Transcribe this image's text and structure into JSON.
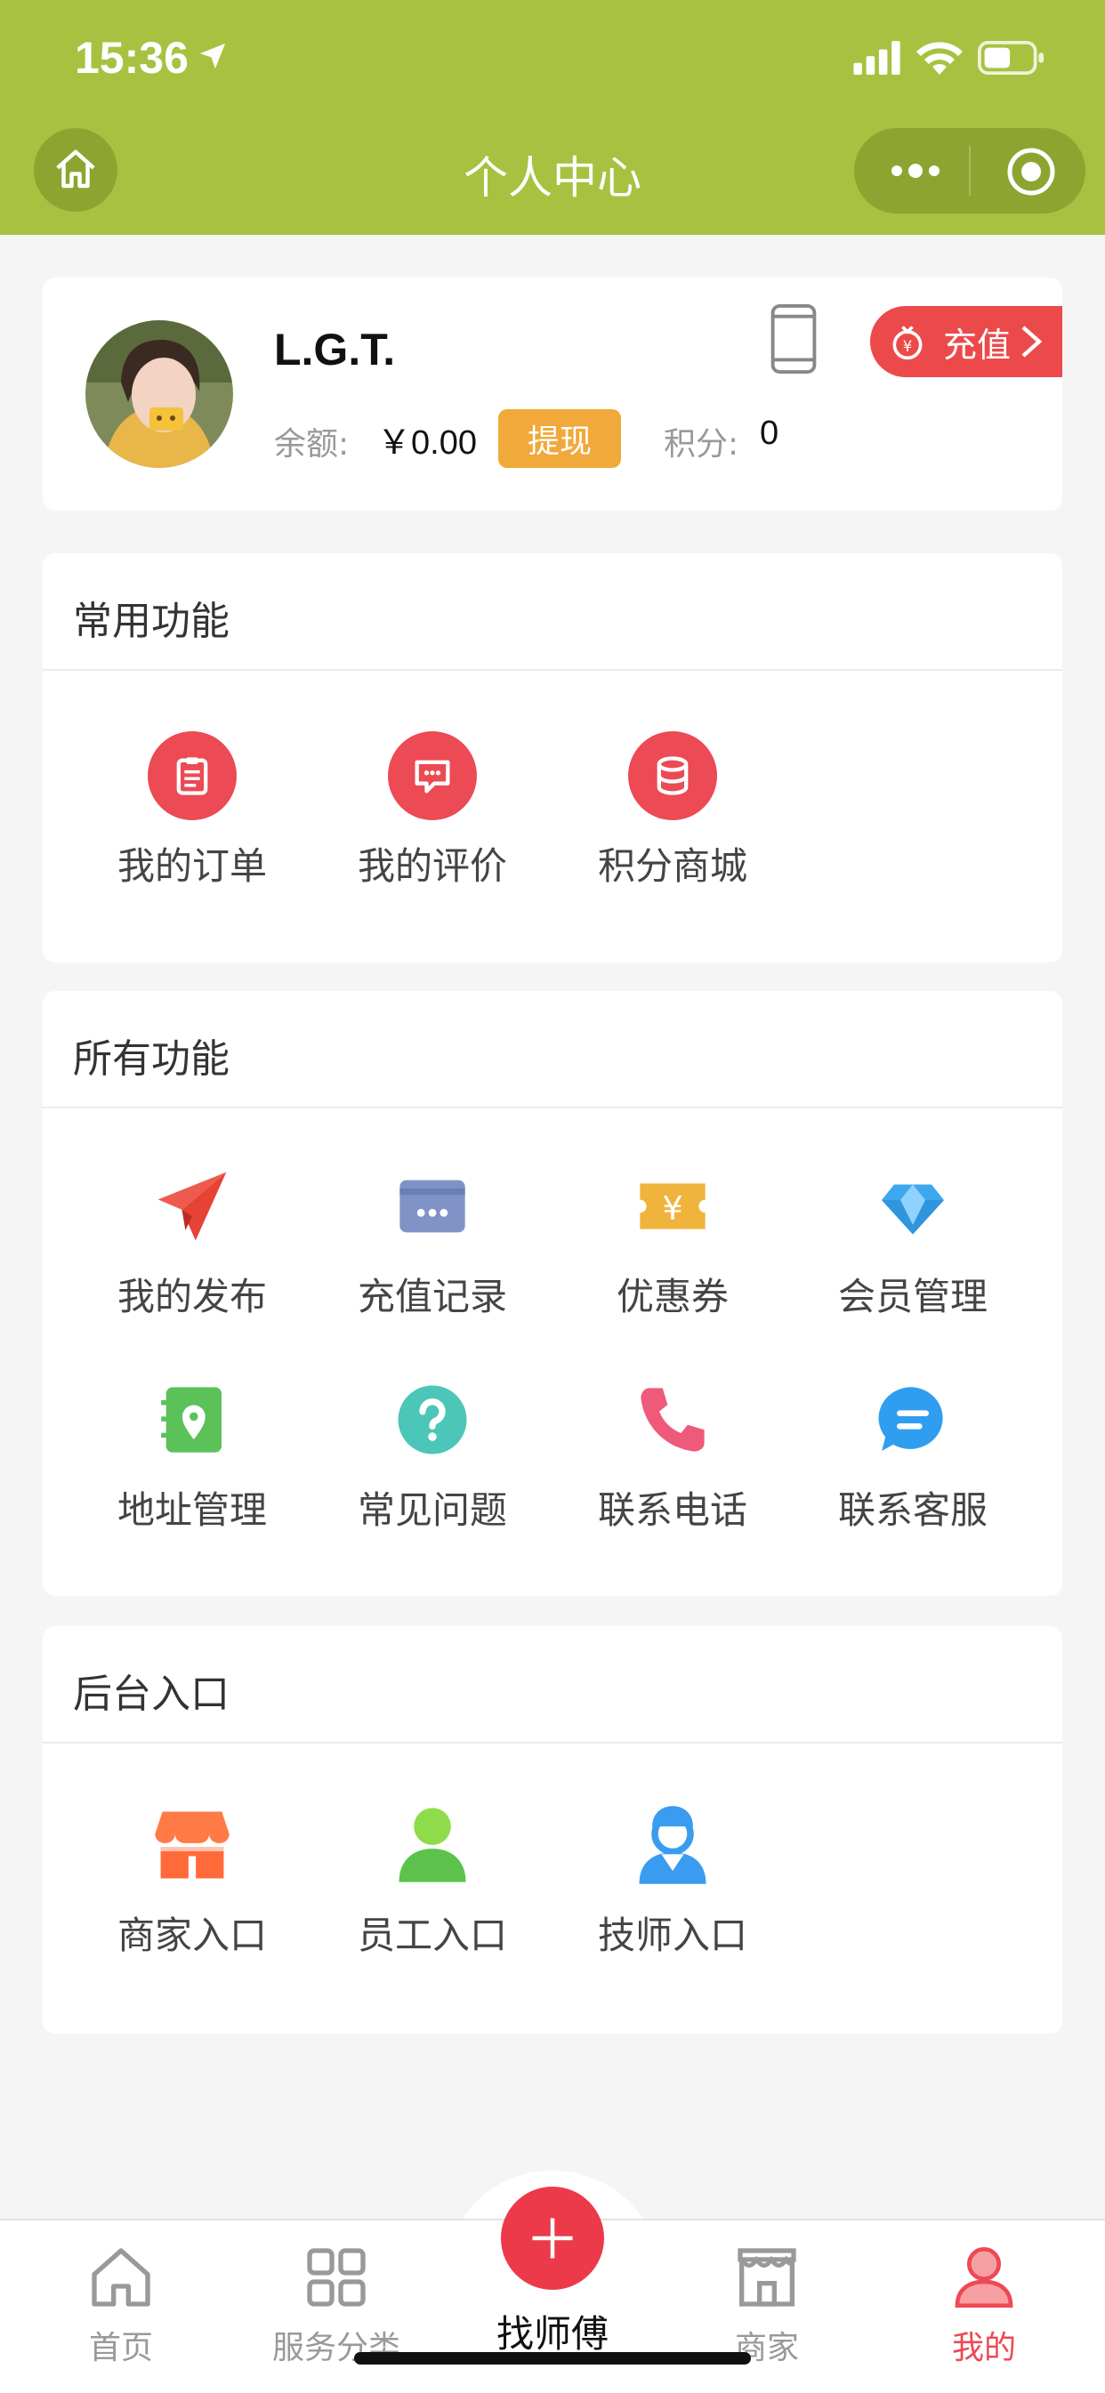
{
  "status_bar": {
    "time": "15:36"
  },
  "nav": {
    "title": "个人中心"
  },
  "profile": {
    "name": "L.G.T.",
    "balance_label": "余额:",
    "balance_value": "￥0.00",
    "withdraw_label": "提现",
    "points_label": "积分:",
    "points_value": "0",
    "recharge_label": "充值"
  },
  "common": {
    "title": "常用功能",
    "items": [
      {
        "label": "我的订单",
        "icon": "clipboard-icon"
      },
      {
        "label": "我的评价",
        "icon": "comment-icon"
      },
      {
        "label": "积分商城",
        "icon": "database-icon"
      }
    ]
  },
  "all": {
    "title": "所有功能",
    "items": [
      {
        "label": "我的发布",
        "icon": "paper-plane-icon"
      },
      {
        "label": "充值记录",
        "icon": "card-icon"
      },
      {
        "label": "优惠券",
        "icon": "coupon-icon"
      },
      {
        "label": "会员管理",
        "icon": "diamond-icon"
      },
      {
        "label": "地址管理",
        "icon": "address-book-icon"
      },
      {
        "label": "常见问题",
        "icon": "question-icon"
      },
      {
        "label": "联系电话",
        "icon": "phone-icon"
      },
      {
        "label": "联系客服",
        "icon": "chat-icon"
      }
    ]
  },
  "backend": {
    "title": "后台入口",
    "items": [
      {
        "label": "商家入口",
        "icon": "shop-icon"
      },
      {
        "label": "员工入口",
        "icon": "employee-icon"
      },
      {
        "label": "技师入口",
        "icon": "technician-icon"
      }
    ]
  },
  "tabbar": {
    "home": "首页",
    "categories": "服务分类",
    "center": "找师傅",
    "merchants": "商家",
    "mine": "我的"
  },
  "colors": {
    "brand_green": "#a8c140",
    "accent_red": "#ec4a54",
    "withdraw_orange": "#f0a93a"
  }
}
